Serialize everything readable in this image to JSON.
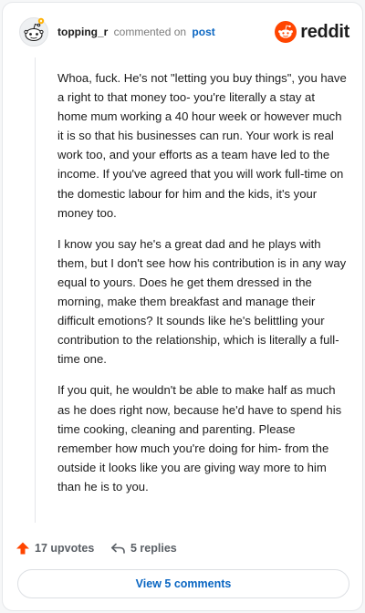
{
  "header": {
    "username": "topping_r",
    "action_text": "commented on",
    "post_link": "post",
    "brand_name": "reddit"
  },
  "comment": {
    "paragraphs": [
      "Whoa, fuck. He's not \"letting you buy things\", you have a right to that money too- you're literally a stay at home mum working a 40 hour week or however much it is so that his businesses can run. Your work is real work too, and your efforts as a team have led to the income. If you've agreed that you will work full-time on the domestic labour for him and the kids, it's your money too.",
      "I know you say he's a great dad and he plays with them, but I don't see how his contribution is in any way equal to yours. Does he get them dressed in the morning, make them breakfast and manage their difficult emotions? It sounds like he's belittling your contribution to the relationship, which is literally a full-time one.",
      "If you quit, he wouldn't be able to make half as much as he does right now, because he'd have to spend his time cooking, cleaning and parenting. Please remember how much you're doing for him- from the outside it looks like you are giving way more to him than he is to you."
    ]
  },
  "footer": {
    "upvotes_label": "17 upvotes",
    "replies_label": "5 replies",
    "view_comments_label": "View 5 comments"
  },
  "icons": {
    "avatar": "reddit-snoo-avatar-icon",
    "brand": "reddit-logo-icon",
    "upvote": "upvote-arrow-icon",
    "reply": "reply-arrow-icon"
  },
  "colors": {
    "brand_orange": "#ff4500",
    "link_blue": "#0a66c2",
    "muted_text": "#7c7c7c"
  }
}
